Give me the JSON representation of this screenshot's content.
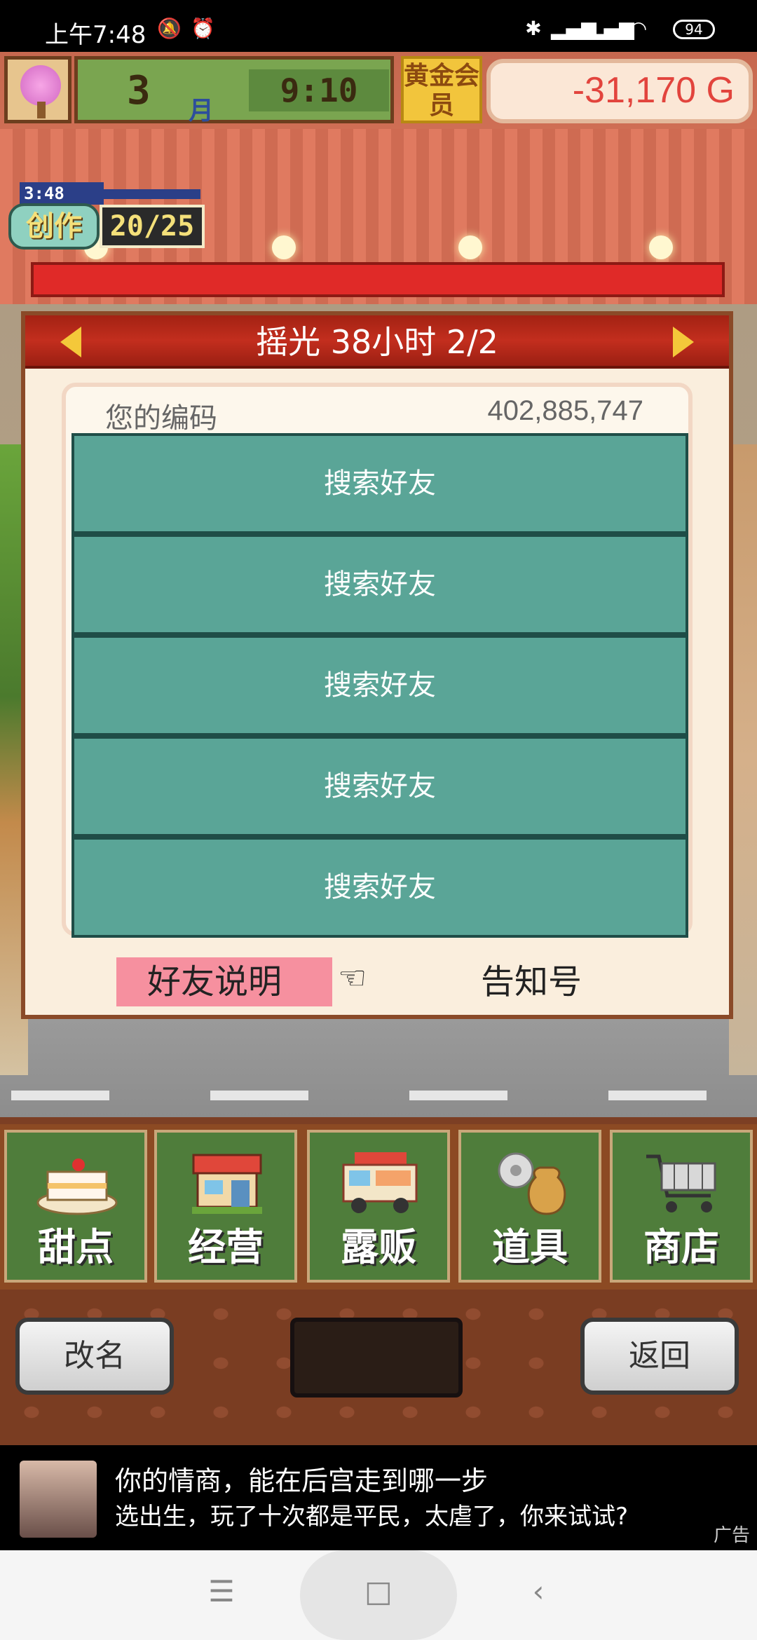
{
  "status_bar": {
    "time": "上午7:48",
    "battery": "94"
  },
  "hud": {
    "month_number": "3",
    "month_label": "月",
    "clock": "9:10",
    "gold_badge": "黄金会员",
    "money": "-31,170 G",
    "create_timer": "3:48",
    "create_label": "创作",
    "create_count": "20/25"
  },
  "dialog": {
    "title": "摇光  38小时 2/2",
    "code_label": "您的编码",
    "code_value": "402,885,747",
    "slots": [
      "搜索好友",
      "搜索好友",
      "搜索好友",
      "搜索好友",
      "搜索好友"
    ],
    "friend_help": "好友说明",
    "notice": "告知号"
  },
  "menu": {
    "items": [
      {
        "label": "甜点",
        "icon": "cake-icon"
      },
      {
        "label": "经营",
        "icon": "shop-icon"
      },
      {
        "label": "露贩",
        "icon": "food-truck-icon"
      },
      {
        "label": "道具",
        "icon": "items-bag-icon"
      },
      {
        "label": "商店",
        "icon": "shopping-cart-icon"
      }
    ]
  },
  "controls": {
    "rename": "改名",
    "back": "返回"
  },
  "ad": {
    "line1": "你的情商，能在后宫走到哪一步",
    "line2": "选出生，玩了十次都是平民，太虐了，你来试试?",
    "tag": "广告"
  },
  "colors": {
    "dialog_header": "#b0271a",
    "slot_teal": "#5aa597",
    "money_red": "#e2443d",
    "help_pink": "#f6909f"
  }
}
